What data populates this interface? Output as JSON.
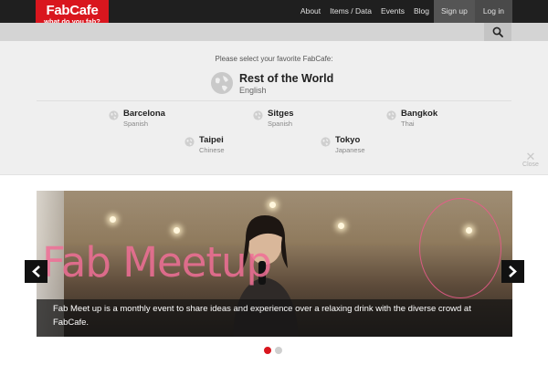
{
  "brand": {
    "name": "FabCafe",
    "tagline": "what do you fab?",
    "color": "#d9161e"
  },
  "nav": [
    {
      "label": "About"
    },
    {
      "label": "Items / Data"
    },
    {
      "label": "Events"
    },
    {
      "label": "Blog"
    },
    {
      "label": "Sign up"
    },
    {
      "label": "Log in"
    }
  ],
  "search": {
    "icon": "search-icon"
  },
  "selector": {
    "prompt": "Please select your favorite FabCafe:",
    "current": {
      "name": "Rest of the World",
      "language": "English",
      "icon": "globe-icon"
    },
    "cafes": [
      {
        "name": "Barcelona",
        "language": "Spanish"
      },
      {
        "name": "Sitges",
        "language": "Spanish"
      },
      {
        "name": "Bangkok",
        "language": "Thai"
      },
      {
        "name": "Taipei",
        "language": "Chinese"
      },
      {
        "name": "Tokyo",
        "language": "Japanese"
      }
    ],
    "close_label": "Close"
  },
  "slider": {
    "overlay_title": "Fab Meetup",
    "caption": "Fab Meet up is a monthly event to share ideas and experience over a relaxing drink with the diverse crowd at FabCafe.",
    "slide_count": 2,
    "active_index": 0
  }
}
